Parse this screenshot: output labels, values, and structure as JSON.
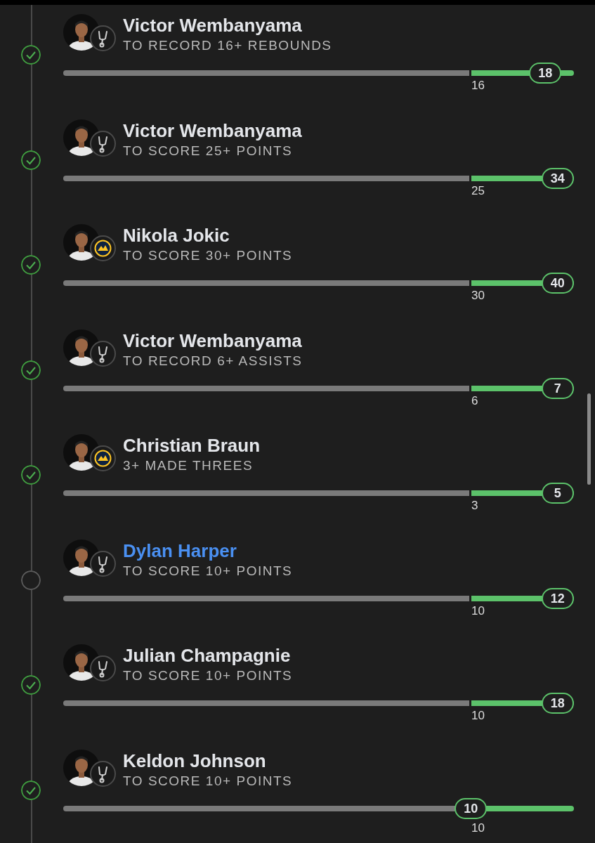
{
  "legs": [
    {
      "player": "Victor Wembanyama",
      "kind": "spurs",
      "prop": "TO RECORD 16+ REBOUNDS",
      "threshold": "16",
      "value": "18",
      "level": 0.944,
      "checked": true,
      "highlighted": false
    },
    {
      "player": "Victor Wembanyama",
      "kind": "spurs",
      "prop": "TO SCORE 25+ POINTS",
      "threshold": "25",
      "value": "34",
      "level": 0.968,
      "checked": true,
      "highlighted": false
    },
    {
      "player": "Nikola Jokic",
      "kind": "nuggets",
      "prop": "TO SCORE 30+ POINTS",
      "threshold": "30",
      "value": "40",
      "level": 0.968,
      "checked": true,
      "highlighted": false
    },
    {
      "player": "Victor Wembanyama",
      "kind": "spurs",
      "prop": "TO RECORD 6+ ASSISTS",
      "threshold": "6",
      "value": "7",
      "level": 0.968,
      "checked": true,
      "highlighted": false
    },
    {
      "player": "Christian Braun",
      "kind": "nuggets",
      "prop": "3+ MADE THREES",
      "threshold": "3",
      "value": "5",
      "level": 0.968,
      "checked": true,
      "highlighted": false
    },
    {
      "player": "Dylan Harper",
      "kind": "spurs",
      "prop": "TO SCORE 10+ POINTS",
      "threshold": "10",
      "value": "12",
      "level": 0.968,
      "checked": false,
      "highlighted": true
    },
    {
      "player": "Julian Champagnie",
      "kind": "spurs",
      "prop": "TO SCORE 10+ POINTS",
      "threshold": "10",
      "value": "18",
      "level": 0.968,
      "checked": true,
      "highlighted": false
    },
    {
      "player": "Keldon Johnson",
      "kind": "spurs",
      "prop": "TO SCORE 10+ POINTS",
      "threshold": "10",
      "value": "10",
      "level": 0.798,
      "checked": true,
      "highlighted": false
    }
  ]
}
